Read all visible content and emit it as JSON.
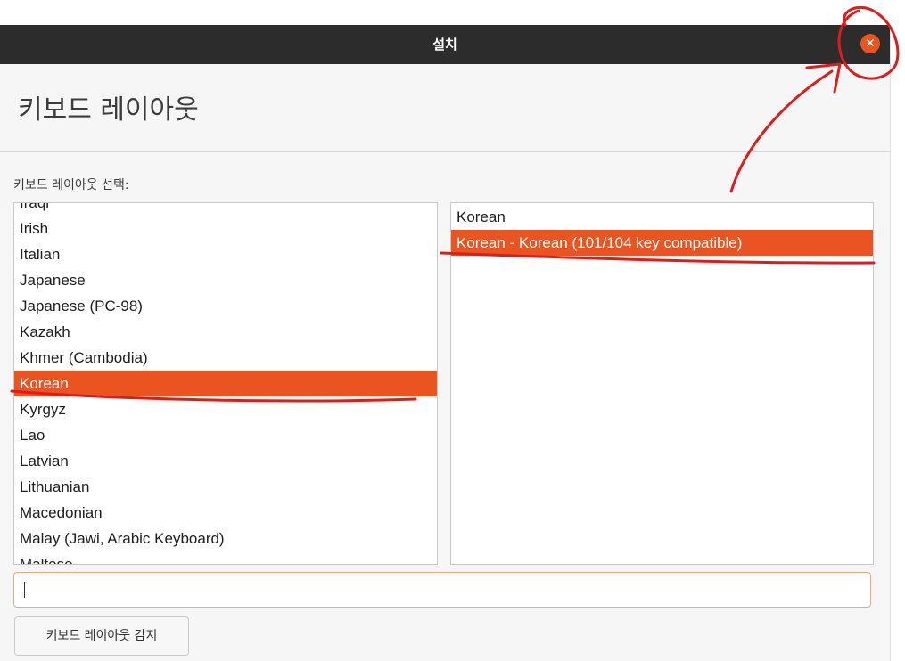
{
  "window": {
    "title": "설치",
    "close_glyph": "✕"
  },
  "page": {
    "heading": "키보드 레이아웃",
    "select_label": "키보드 레이아웃 선택:"
  },
  "layouts": {
    "items": [
      "Iraqi",
      "Irish",
      "Italian",
      "Japanese",
      "Japanese (PC-98)",
      "Kazakh",
      "Khmer (Cambodia)",
      "Korean",
      "Kyrgyz",
      "Lao",
      "Latvian",
      "Lithuanian",
      "Macedonian",
      "Malay (Jawi, Arabic Keyboard)",
      "Maltese"
    ],
    "selected": "Korean"
  },
  "variants": {
    "items": [
      "Korean",
      "Korean - Korean (101/104 key compatible)"
    ],
    "selected": "Korean - Korean (101/104 key compatible)"
  },
  "search": {
    "value": ""
  },
  "detect_button": {
    "label": "키보드 레이아웃 감지"
  },
  "colors": {
    "accent": "#e95420",
    "annotation": "#e11b1b",
    "titlebar": "#2c2c2c"
  }
}
